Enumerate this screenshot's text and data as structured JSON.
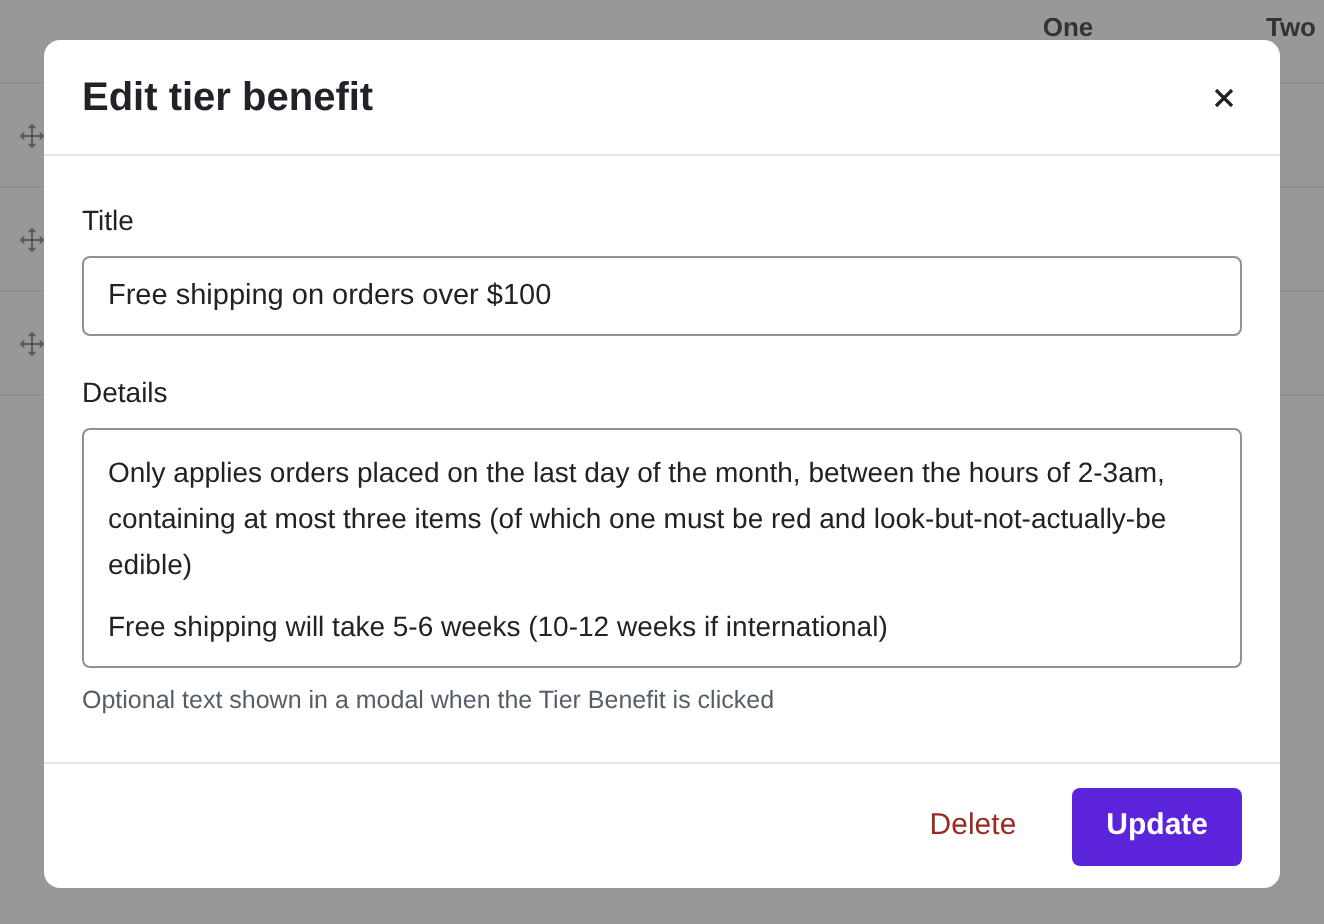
{
  "background_table": {
    "columns": [
      "One",
      "Two"
    ]
  },
  "dialog": {
    "title": "Edit tier benefit",
    "fields": [
      {
        "kind": "input",
        "label": "Title",
        "value": "Free shipping on orders over $100"
      },
      {
        "kind": "textarea",
        "label": "Details",
        "paragraphs": [
          "Only applies orders placed on the last day of the month, between the hours of 2-3am, containing at most three items (of which one must be red and look-but-not-actually-be edible)",
          "Free shipping will take 5-6 weeks (10-12 weeks if international)"
        ],
        "help": "Optional text shown in a modal when the Tier Benefit is clicked"
      }
    ],
    "buttons": [
      {
        "kind": "danger",
        "label": "Delete"
      },
      {
        "kind": "primary",
        "label": "Update"
      }
    ]
  }
}
